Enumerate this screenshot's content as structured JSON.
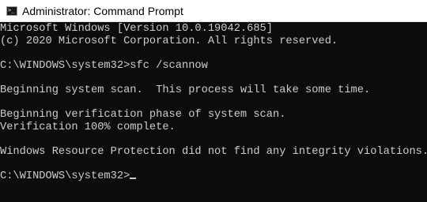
{
  "window": {
    "title": "Administrator: Command Prompt",
    "icon": "command-prompt-icon"
  },
  "console": {
    "lines": [
      "Microsoft Windows [Version 10.0.19042.685]",
      "(c) 2020 Microsoft Corporation. All rights reserved.",
      "",
      "C:\\WINDOWS\\system32>sfc /scannow",
      "",
      "Beginning system scan.  This process will take some time.",
      "",
      "Beginning verification phase of system scan.",
      "Verification 100% complete.",
      "",
      "Windows Resource Protection did not find any integrity violations.",
      "",
      "C:\\WINDOWS\\system32>"
    ]
  },
  "colors": {
    "console_bg": "#0c0c0c",
    "console_text": "#cccccc",
    "titlebar_bg": "#ffffff"
  }
}
